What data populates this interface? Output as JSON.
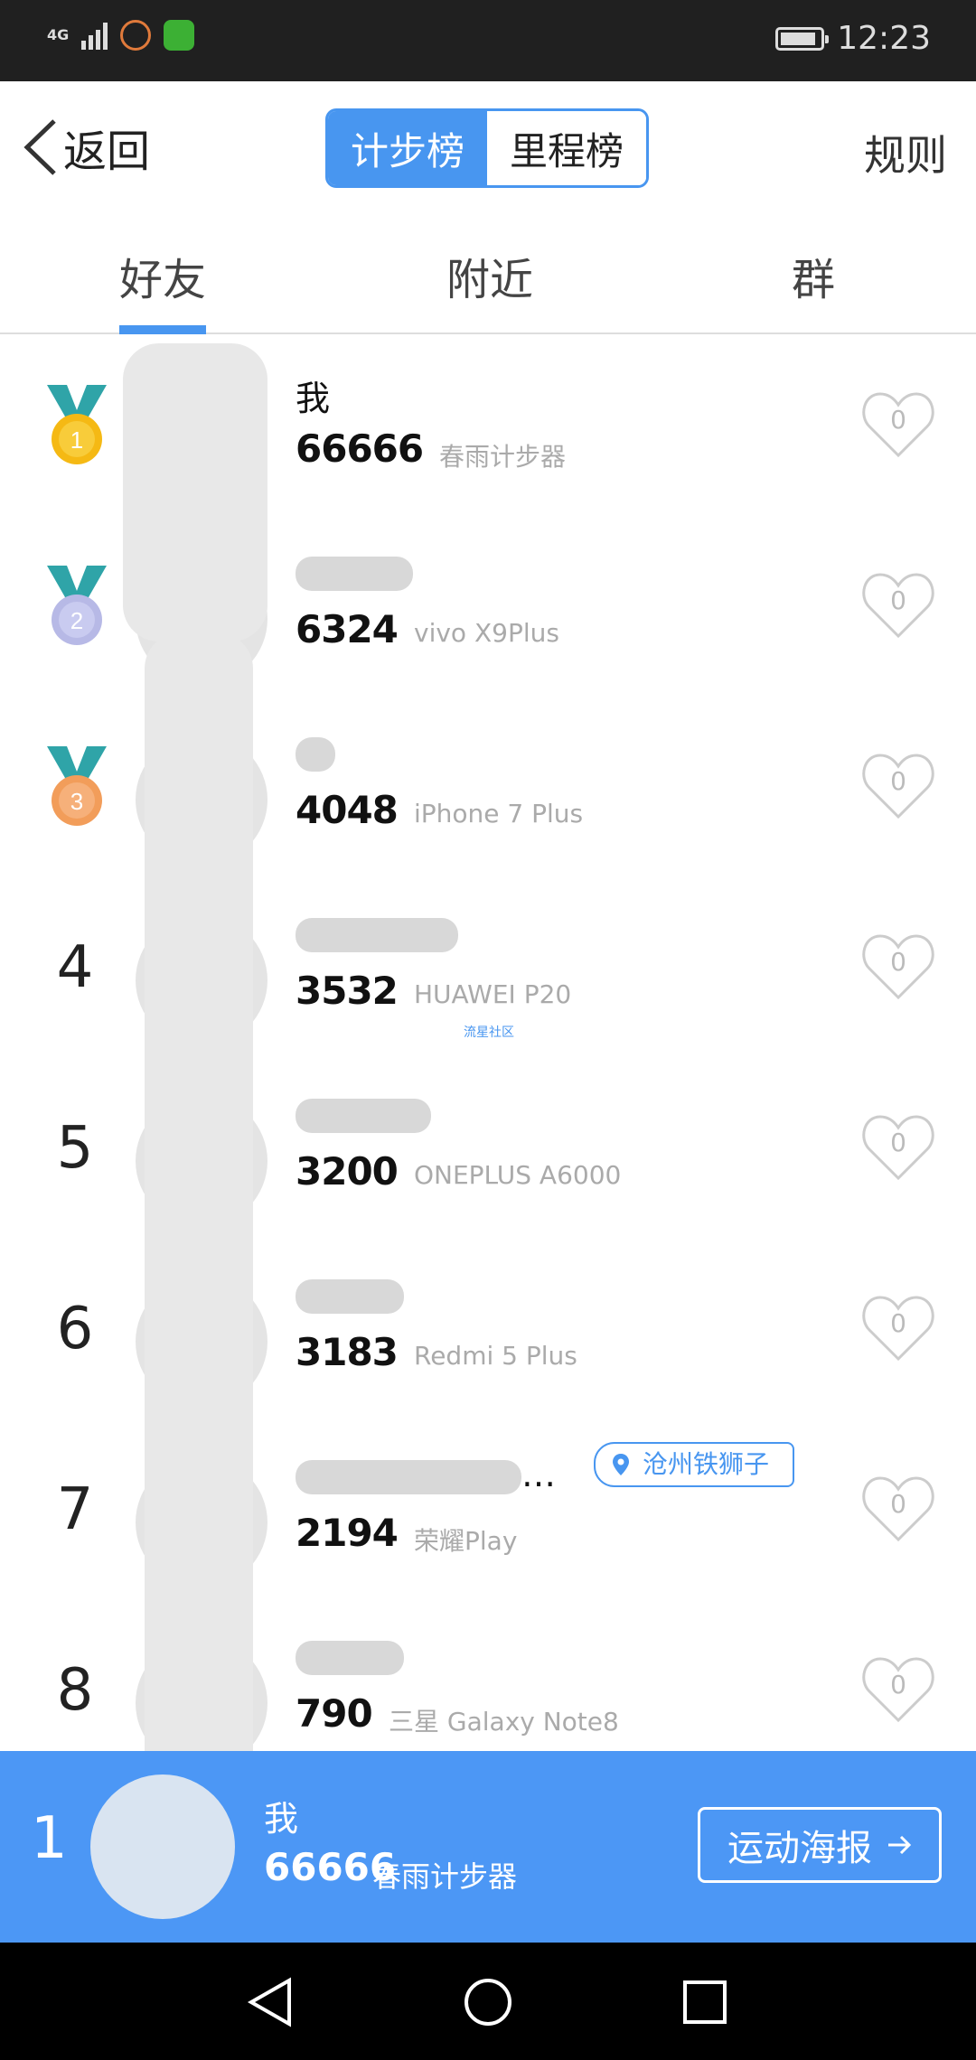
{
  "status_bar": {
    "network": "4G",
    "time": "12:23"
  },
  "nav": {
    "back_label": "返回",
    "segments": [
      "计步榜",
      "里程榜"
    ],
    "active_segment": 0,
    "rules_label": "规则"
  },
  "tabs": [
    {
      "label": "好友",
      "active": true
    },
    {
      "label": "附近",
      "active": false
    },
    {
      "label": "群",
      "active": false
    }
  ],
  "rankings": [
    {
      "rank": "1",
      "medal": "gold-medal-icon",
      "name": "我",
      "steps": "66666",
      "device": "春雨计步器",
      "likes": "0"
    },
    {
      "rank": "2",
      "medal": "silver-medal-icon",
      "name": "",
      "steps": "6324",
      "device": "vivo X9Plus",
      "likes": "0"
    },
    {
      "rank": "3",
      "medal": "bronze-medal-icon",
      "name": "",
      "steps": "4048",
      "device": "iPhone 7 Plus",
      "likes": "0"
    },
    {
      "rank": "4",
      "name": "",
      "steps": "3532",
      "device": "HUAWEI P20",
      "likes": "0"
    },
    {
      "rank": "5",
      "name": "",
      "steps": "3200",
      "device": "ONEPLUS A6000",
      "likes": "0"
    },
    {
      "rank": "6",
      "name": "",
      "steps": "3183",
      "device": "Redmi 5 Plus",
      "likes": "0"
    },
    {
      "rank": "7",
      "name": "…",
      "steps": "2194",
      "device": "荣耀Play",
      "likes": "0",
      "location_tag": "沧州铁狮子"
    },
    {
      "rank": "8",
      "name": "",
      "steps": "790",
      "device": "三星 Galaxy Note8",
      "likes": "0"
    }
  ],
  "watermark": "流星社区",
  "my_rank": {
    "rank": "1",
    "name": "我",
    "steps": "66666",
    "device": "春雨计步器",
    "poster_label": "运动海报"
  },
  "colors": {
    "accent": "#4896f0",
    "status_bar": "#202020",
    "my_bar": "#4c97f5"
  }
}
